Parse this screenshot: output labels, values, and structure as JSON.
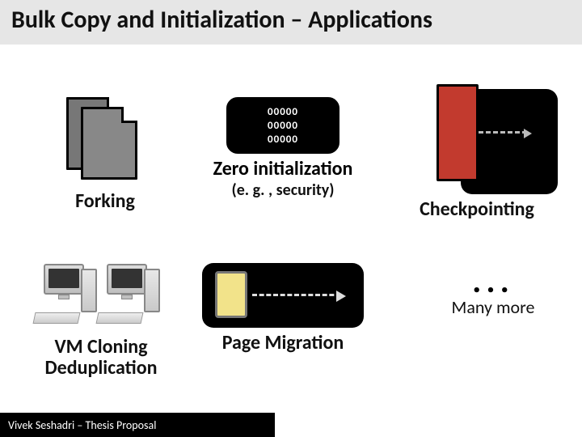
{
  "title": "Bulk Copy and Initialization – Applications",
  "forking": {
    "label": "Forking"
  },
  "zero": {
    "lines": [
      "00000",
      "00000",
      "00000"
    ],
    "label": "Zero initialization",
    "sub": "(e. g. , security)"
  },
  "checkpointing": {
    "label": "Checkpointing"
  },
  "vm": {
    "label_line1": "VM Cloning",
    "label_line2": "Deduplication"
  },
  "page_migration": {
    "label": "Page Migration"
  },
  "more": {
    "dots": "...",
    "label": "Many more"
  },
  "footer": "Vivek Seshadri – Thesis Proposal"
}
